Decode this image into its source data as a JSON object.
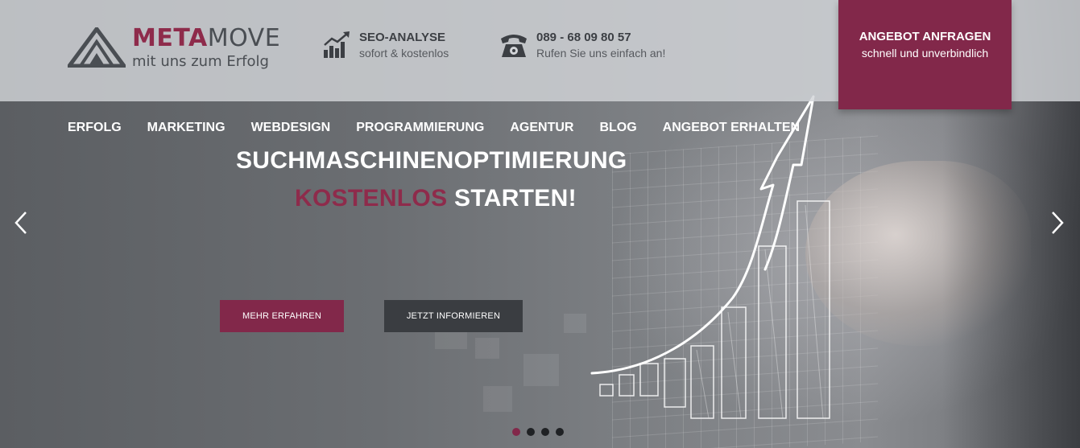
{
  "header": {
    "brand_part1": "META",
    "brand_part2": "MOVE",
    "tagline": "mit uns zum Erfolg",
    "seo": {
      "title": "SEO-ANALYSE",
      "subtitle": "sofort & kostenlos",
      "icon": "bar-chart-icon"
    },
    "phone": {
      "number": "089 - 68 09 80 57",
      "subtitle": "Rufen Sie uns einfach an!",
      "icon": "telephone-icon"
    },
    "cta": {
      "title": "ANGEBOT ANFRAGEN",
      "subtitle": "schnell und unverbindlich"
    }
  },
  "nav": {
    "items": [
      "ERFOLG",
      "MARKETING",
      "WEBDESIGN",
      "PROGRAMMIERUNG",
      "AGENTUR",
      "BLOG",
      "ANGEBOT ERHALTEN"
    ]
  },
  "hero": {
    "headline": "SUCHMASCHINENOPTIMIERUNG",
    "headline2_accent": "KOSTENLOS",
    "headline2_rest": " STARTEN!",
    "button_primary": "MEHR ERFAHREN",
    "button_secondary": "JETZT INFORMIEREN",
    "slides_total": 4,
    "active_slide": 1
  },
  "colors": {
    "accent": "#82284a",
    "dark_button": "#3a3d41",
    "header_bg": "#d2d4d8"
  }
}
